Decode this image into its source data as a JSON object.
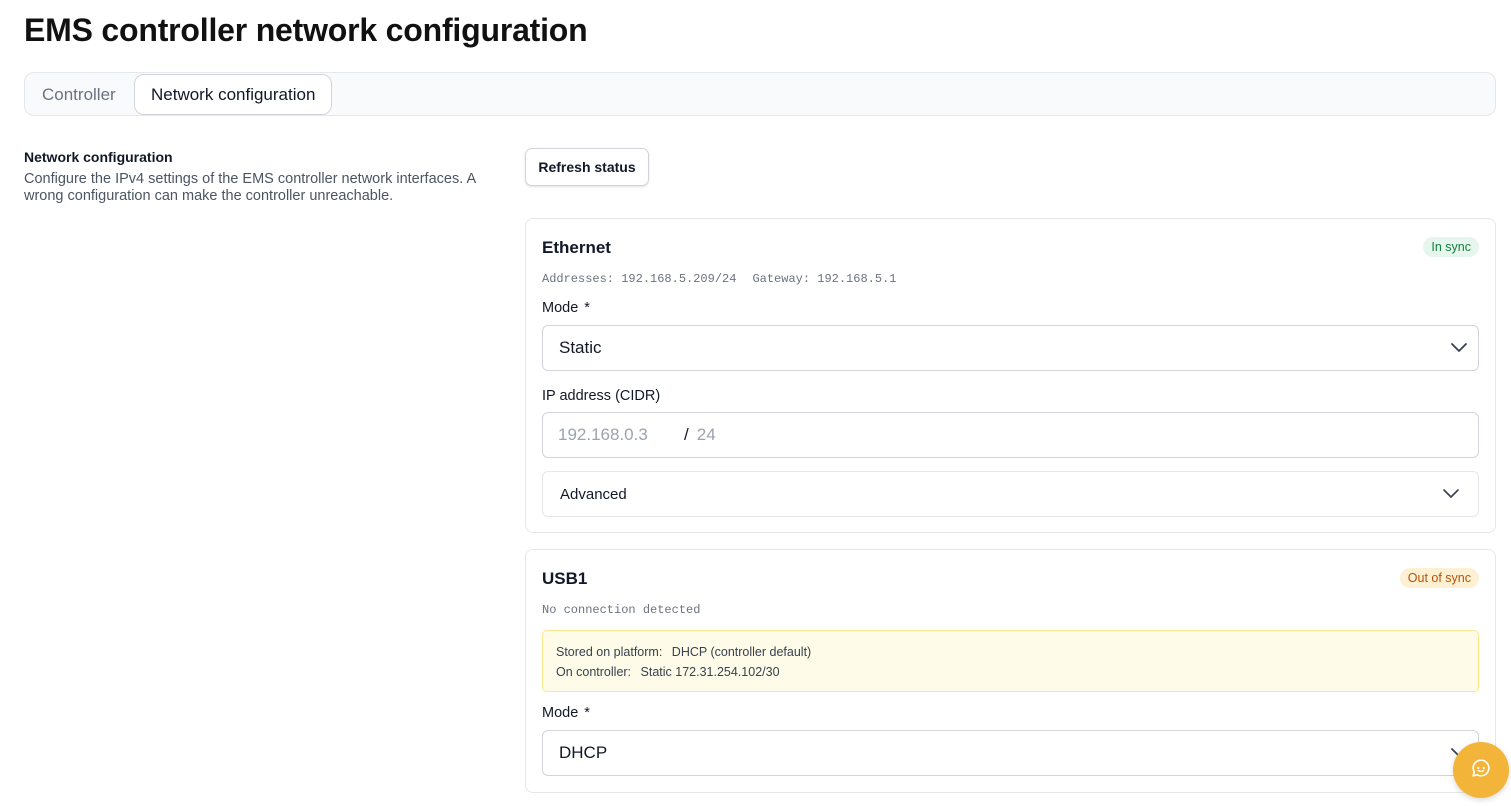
{
  "page": {
    "title": "EMS controller network configuration"
  },
  "tabs": [
    {
      "label": "Controller",
      "active": false
    },
    {
      "label": "Network configuration",
      "active": true
    }
  ],
  "section": {
    "title": "Network configuration",
    "description": "Configure the IPv4 settings of the EMS controller network interfaces. A wrong configuration can make the controller unreachable."
  },
  "actions": {
    "refresh_label": "Refresh status"
  },
  "ethernet": {
    "title": "Ethernet",
    "status": "In sync",
    "status_color": "#15803d",
    "addresses_label": "Addresses:",
    "addresses_value": "192.168.5.209/24",
    "gateway_label": "Gateway:",
    "gateway_value": "192.168.5.1",
    "mode_label": "Mode",
    "required_mark": "*",
    "mode_value": "Static",
    "ip_label": "IP address (CIDR)",
    "ip_placeholder": "192.168.0.3",
    "cidr_separator": "/",
    "mask_placeholder": "24",
    "advanced_label": "Advanced"
  },
  "usb1": {
    "title": "USB1",
    "status": "Out of sync",
    "status_color": "#b45309",
    "connection": "No connection detected",
    "stored_label": "Stored on platform:",
    "stored_value": "DHCP (controller default)",
    "controller_label": "On controller:",
    "controller_value": "Static 172.31.254.102/30",
    "mode_label": "Mode",
    "required_mark": "*",
    "mode_value": "DHCP"
  },
  "icons": {
    "select_chevron": "chevron-down-icon",
    "chat_button": "chat-icon"
  },
  "colors": {
    "accent": "#f3b43a",
    "in_sync_bg": "#e6f6ec",
    "out_of_sync_bg": "#fdf0d3",
    "notice_bg": "#fefce8"
  }
}
